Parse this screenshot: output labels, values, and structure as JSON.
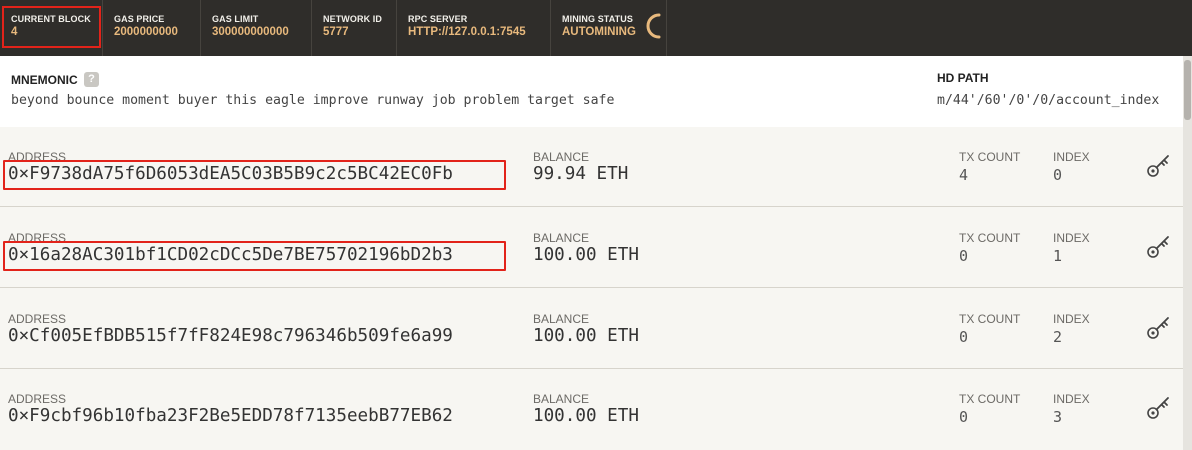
{
  "status": {
    "current_block": {
      "label": "CURRENT BLOCK",
      "value": "4"
    },
    "gas_price": {
      "label": "GAS PRICE",
      "value": "2000000000"
    },
    "gas_limit": {
      "label": "GAS LIMIT",
      "value": "300000000000"
    },
    "network_id": {
      "label": "NETWORK ID",
      "value": "5777"
    },
    "rpc_server": {
      "label": "RPC SERVER",
      "value": "HTTP://127.0.0.1:7545"
    },
    "mining_status": {
      "label": "MINING STATUS",
      "value": "AUTOMINING"
    }
  },
  "mnemonic": {
    "label": "MNEMONIC",
    "help": "?",
    "words": "beyond bounce moment buyer this eagle improve runway job problem target safe",
    "hd_path_label": "HD PATH",
    "hd_path": "m/44'/60'/0'/0/account_index"
  },
  "column_labels": {
    "address": "ADDRESS",
    "balance": "BALANCE",
    "tx_count": "TX COUNT",
    "index": "INDEX"
  },
  "accounts": [
    {
      "address": "0×F9738dA75f6D6053dEA5C03B5B9c2c5BC42EC0Fb",
      "balance": "99.94 ETH",
      "tx_count": "4",
      "index": "0",
      "highlighted": true
    },
    {
      "address": "0×16a28AC301bf1CD02cDCc5De7BE75702196bD2b3",
      "balance": "100.00 ETH",
      "tx_count": "0",
      "index": "1",
      "highlighted": true
    },
    {
      "address": "0×Cf005EfBDB515f7fF824E98c796346b509fe6a99",
      "balance": "100.00 ETH",
      "tx_count": "0",
      "index": "2",
      "highlighted": false
    },
    {
      "address": "0×F9cbf96b10fba23F2Be5EDD78f7135eebB77EB62",
      "balance": "100.00 ETH",
      "tx_count": "0",
      "index": "3",
      "highlighted": false
    }
  ],
  "icons": {
    "spinner": "spinner-icon",
    "key": "key-icon",
    "help": "help-icon"
  },
  "colors": {
    "topbar": "#2f2d2a",
    "accent": "#e8b97d",
    "highlight": "#e2231a"
  }
}
